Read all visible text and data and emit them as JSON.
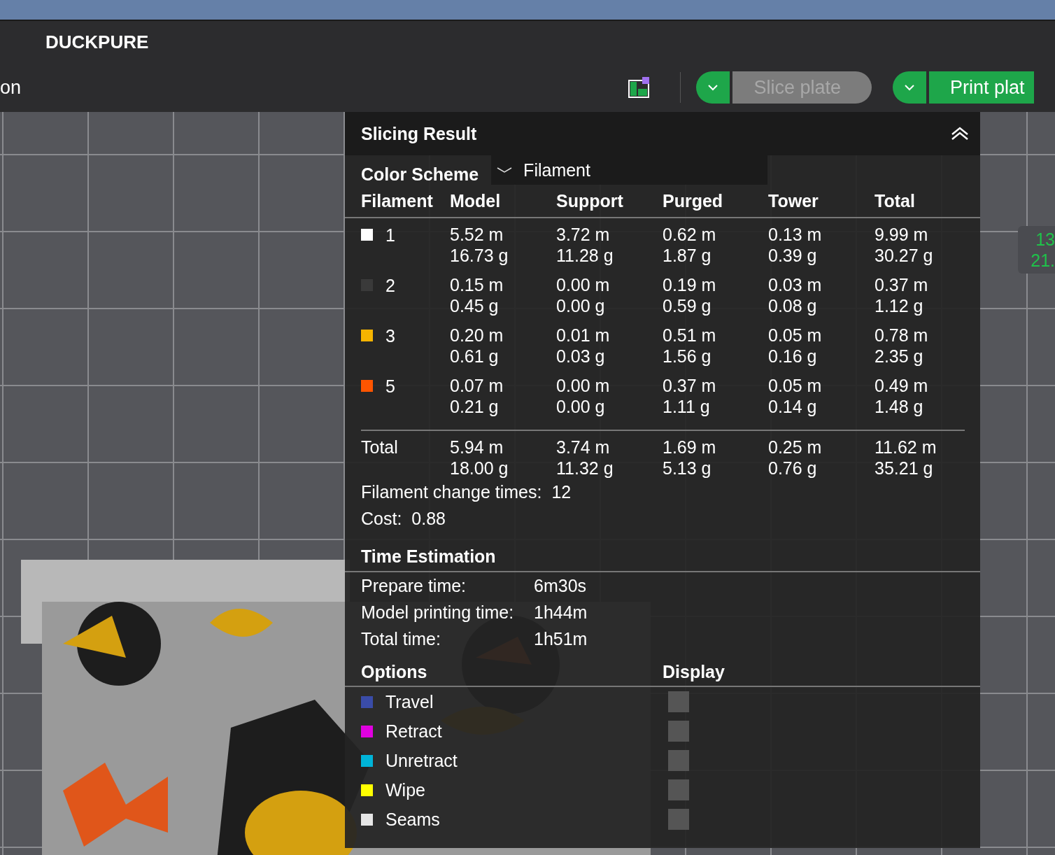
{
  "app_bar": {
    "brand": "DUCKPURE",
    "cut_label": "on",
    "slice_button": {
      "label": "Slice plate",
      "disabled": true
    },
    "print_button": {
      "label": "Print plat",
      "disabled": false
    }
  },
  "side_label": [
    "13",
    "21."
  ],
  "slicing_result": {
    "title": "Slicing Result",
    "expanded": true,
    "color_scheme": {
      "label": "Color Scheme",
      "value": "Filament"
    },
    "columns": [
      "Filament",
      "Model",
      "Support",
      "Purged",
      "Tower",
      "Total"
    ],
    "rows": [
      {
        "color": "#ffffff",
        "cells": [
          [
            "1"
          ],
          [
            "5.52 m",
            "16.73 g"
          ],
          [
            "3.72 m",
            "11.28 g"
          ],
          [
            "0.62 m",
            "1.87 g"
          ],
          [
            "0.13 m",
            "0.39 g"
          ],
          [
            "9.99 m",
            "30.27 g"
          ]
        ]
      },
      {
        "color": "#3a3a3a",
        "cells": [
          [
            "2"
          ],
          [
            "0.15 m",
            "0.45 g"
          ],
          [
            "0.00 m",
            "0.00 g"
          ],
          [
            "0.19 m",
            "0.59 g"
          ],
          [
            "0.03 m",
            "0.08 g"
          ],
          [
            "0.37 m",
            "1.12 g"
          ]
        ]
      },
      {
        "color": "#f5b400",
        "cells": [
          [
            "3"
          ],
          [
            "0.20 m",
            "0.61 g"
          ],
          [
            "0.01 m",
            "0.03 g"
          ],
          [
            "0.51 m",
            "1.56 g"
          ],
          [
            "0.05 m",
            "0.16 g"
          ],
          [
            "0.78 m",
            "2.35 g"
          ]
        ]
      },
      {
        "color": "#ff5500",
        "cells": [
          [
            "5"
          ],
          [
            "0.07 m",
            "0.21 g"
          ],
          [
            "0.00 m",
            "0.00 g"
          ],
          [
            "0.37 m",
            "1.11 g"
          ],
          [
            "0.05 m",
            "0.14 g"
          ],
          [
            "0.49 m",
            "1.48 g"
          ]
        ]
      }
    ],
    "total": {
      "cells": [
        [
          "Total"
        ],
        [
          "5.94 m",
          "18.00 g"
        ],
        [
          "3.74 m",
          "11.32 g"
        ],
        [
          "1.69 m",
          "5.13 g"
        ],
        [
          "0.25 m",
          "0.76 g"
        ],
        [
          "11.62 m",
          "35.21 g"
        ]
      ]
    },
    "summary": [
      {
        "label": "Filament change times:",
        "value": "12"
      },
      {
        "label": "Cost:",
        "value": "0.88"
      }
    ]
  },
  "time_estimation": {
    "title": "Time Estimation",
    "items": [
      {
        "label": "Prepare time:",
        "value": "6m30s"
      },
      {
        "label": "Model printing time:",
        "value": "1h44m"
      },
      {
        "label": "Total time:",
        "value": "1h51m"
      }
    ]
  },
  "options": {
    "title": "Options",
    "display_title": "Display",
    "items": [
      {
        "label": "Travel",
        "color": "#3a4ca8",
        "display": false
      },
      {
        "label": "Retract",
        "color": "#e000e0",
        "display": false
      },
      {
        "label": "Unretract",
        "color": "#00b4d8",
        "display": false
      },
      {
        "label": "Wipe",
        "color": "#ffff00",
        "display": false
      },
      {
        "label": "Seams",
        "color": "#e6e6e6",
        "display": false
      }
    ]
  }
}
